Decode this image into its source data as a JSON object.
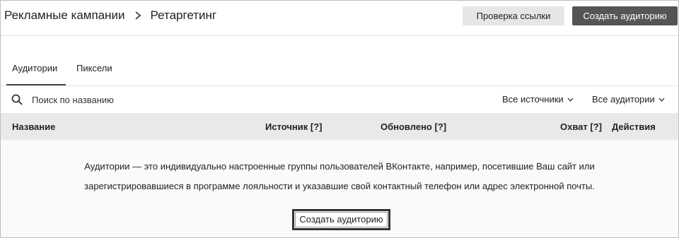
{
  "header": {
    "breadcrumb_root": "Рекламные кампании",
    "breadcrumb_current": "Ретаргетинг",
    "check_link_label": "Проверка ссылки",
    "create_audience_label": "Создать аудиторию"
  },
  "tabs": [
    {
      "label": "Аудитории",
      "active": true
    },
    {
      "label": "Пиксели",
      "active": false
    }
  ],
  "search": {
    "placeholder": "Поиск по названию",
    "value": ""
  },
  "filters": {
    "sources_label": "Все источники",
    "audiences_label": "Все аудитории"
  },
  "table": {
    "columns": [
      "Название",
      "Источник [?]",
      "Обновлено [?]",
      "Охват [?]",
      "Действия"
    ]
  },
  "empty_state": {
    "line1": "Аудитории — это индивидуально настроенные группы пользователей ВКонтакте, например, посетившие Ваш сайт или",
    "line2": "зарегистрировавшиеся в программе лояльности и указавшие свой контактный телефон или адрес электронной почты.",
    "button_label": "Создать аудиторию"
  },
  "colors": {
    "primary_button": "#555555",
    "secondary_button": "#e6e6e6",
    "table_header_bg": "#e9e9e9"
  },
  "icons": [
    "chevron-right-icon",
    "search-icon",
    "chevron-down-icon"
  ]
}
